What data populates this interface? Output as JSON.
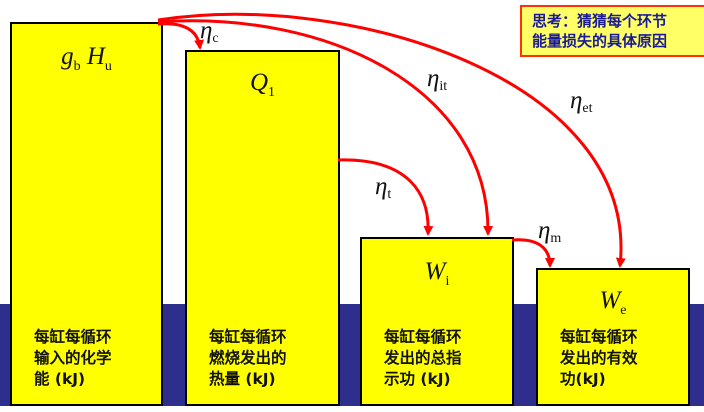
{
  "note": {
    "line1": "思考：猜猜每个环节",
    "line2": "能量损失的具体原因"
  },
  "boxes": [
    {
      "symbol": "g",
      "symbol_sub": "b",
      "symbol2": "H",
      "symbol2_sub": "u",
      "desc": [
        "每缸每循环",
        "输入的化学",
        "能 (kJ)"
      ]
    },
    {
      "symbol": "Q",
      "symbol_sub": "1",
      "desc": [
        "每缸每循环",
        "燃烧发出的",
        "热量 (kJ)"
      ]
    },
    {
      "symbol": "W",
      "symbol_sub": "i",
      "desc": [
        "每缸每循环",
        "发出的总指",
        "示功 (kJ)"
      ]
    },
    {
      "symbol": "W",
      "symbol_sub": "e",
      "desc": [
        "每缸每循环",
        "发出的有效",
        "功(kJ)"
      ]
    }
  ],
  "efficiencies": [
    {
      "symbol": "η",
      "sub": "c"
    },
    {
      "symbol": "η",
      "sub": "it"
    },
    {
      "symbol": "η",
      "sub": "et"
    },
    {
      "symbol": "η",
      "sub": "t"
    },
    {
      "symbol": "η",
      "sub": "m"
    }
  ],
  "colors": {
    "box_fill": "#ffff00",
    "band": "#2e2f8c",
    "arrow": "#ff0000",
    "note_fill": "#ffff66",
    "note_border": "#ff3300",
    "note_text": "#1a1a99"
  }
}
